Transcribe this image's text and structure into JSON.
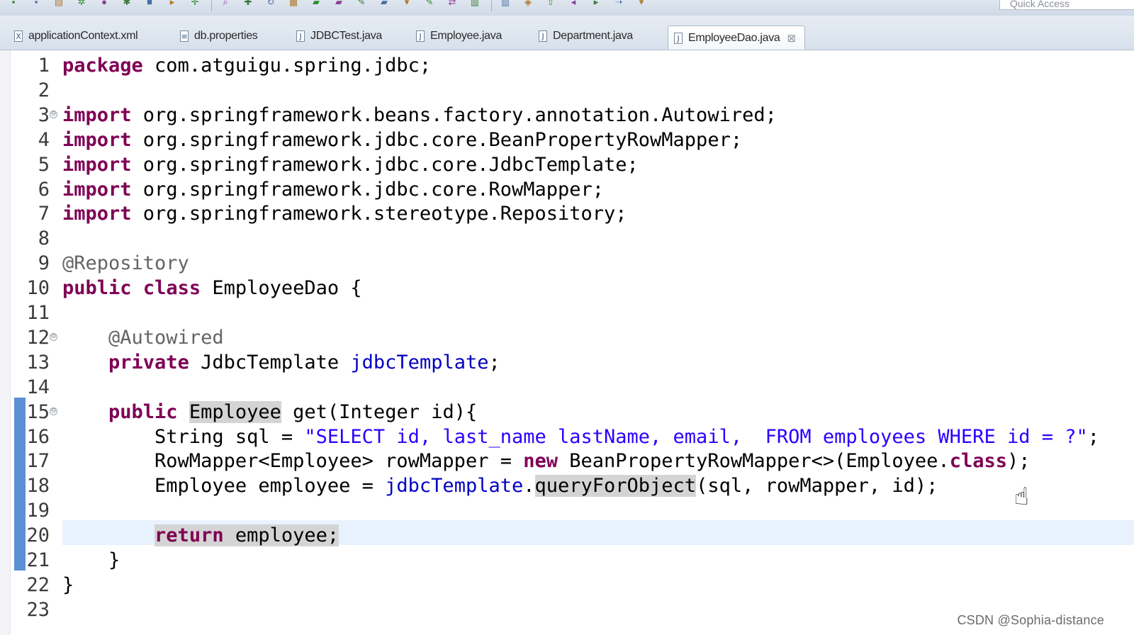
{
  "toolbar": {
    "icons": [
      "save-icon",
      "save-all-icon",
      "print-icon",
      "debug-icon",
      "run-icon",
      "run-external-icon",
      "stop-icon",
      "run-last-icon",
      "new-icon",
      "search-icon",
      "build-icon",
      "refresh-icon",
      "open-type-icon",
      "open-folder-icon",
      "open-file-icon",
      "pin-icon",
      "open-icon",
      "next-annotation-icon",
      "highlight-icon",
      "toggle-icon",
      "layout-icon",
      "columns-icon",
      "tag-icon",
      "up-icon",
      "back-icon",
      "forward-icon",
      "nav-icon",
      "menu-icon"
    ],
    "quick_access_label": "Quick Access"
  },
  "tabs": [
    {
      "label": "applicationContext.xml",
      "icon": "xml-file-icon",
      "glyph": "X",
      "active": false
    },
    {
      "label": "db.properties",
      "icon": "properties-file-icon",
      "glyph": "≡",
      "active": false
    },
    {
      "label": "JDBCTest.java",
      "icon": "java-file-icon",
      "glyph": "J",
      "active": false
    },
    {
      "label": "Employee.java",
      "icon": "java-file-icon",
      "glyph": "J",
      "active": false
    },
    {
      "label": "Department.java",
      "icon": "java-file-icon",
      "glyph": "J",
      "active": false
    },
    {
      "label": "EmployeeDao.java",
      "icon": "java-file-icon",
      "glyph": "J",
      "active": true,
      "close": "⊠"
    }
  ],
  "editor": {
    "fold_glyph": "⊖",
    "lines": [
      {
        "n": "1",
        "fold": false,
        "tokens": [
          {
            "t": "package",
            "c": "kw"
          },
          {
            "t": " com.atguigu.spring.jdbc;"
          }
        ]
      },
      {
        "n": "2",
        "fold": false,
        "tokens": []
      },
      {
        "n": "3",
        "fold": true,
        "tokens": [
          {
            "t": "import",
            "c": "kw"
          },
          {
            "t": " org.springframework.beans.factory.annotation.Autowired;"
          }
        ]
      },
      {
        "n": "4",
        "fold": false,
        "tokens": [
          {
            "t": "import",
            "c": "kw"
          },
          {
            "t": " org.springframework.jdbc.core.BeanPropertyRowMapper;"
          }
        ]
      },
      {
        "n": "5",
        "fold": false,
        "tokens": [
          {
            "t": "import",
            "c": "kw"
          },
          {
            "t": " org.springframework.jdbc.core.JdbcTemplate;"
          }
        ]
      },
      {
        "n": "6",
        "fold": false,
        "tokens": [
          {
            "t": "import",
            "c": "kw"
          },
          {
            "t": " org.springframework.jdbc.core.RowMapper;"
          }
        ]
      },
      {
        "n": "7",
        "fold": false,
        "tokens": [
          {
            "t": "import",
            "c": "kw"
          },
          {
            "t": " org.springframework.stereotype.Repository;"
          }
        ]
      },
      {
        "n": "8",
        "fold": false,
        "tokens": []
      },
      {
        "n": "9",
        "fold": false,
        "tokens": [
          {
            "t": "@Repository",
            "c": "ann"
          }
        ]
      },
      {
        "n": "10",
        "fold": false,
        "tokens": [
          {
            "t": "public",
            "c": "kw"
          },
          {
            "t": " "
          },
          {
            "t": "class",
            "c": "kw"
          },
          {
            "t": " EmployeeDao {"
          }
        ]
      },
      {
        "n": "11",
        "fold": false,
        "tokens": []
      },
      {
        "n": "12",
        "fold": true,
        "tokens": [
          {
            "t": "    "
          },
          {
            "t": "@Autowired",
            "c": "ann"
          }
        ]
      },
      {
        "n": "13",
        "fold": false,
        "tokens": [
          {
            "t": "    "
          },
          {
            "t": "private",
            "c": "kw"
          },
          {
            "t": " JdbcTemplate "
          },
          {
            "t": "jdbcTemplate",
            "c": "fld"
          },
          {
            "t": ";"
          }
        ]
      },
      {
        "n": "14",
        "fold": false,
        "tokens": []
      },
      {
        "n": "15",
        "fold": true,
        "tokens": [
          {
            "t": "    "
          },
          {
            "t": "public",
            "c": "kw"
          },
          {
            "t": " "
          },
          {
            "t": "Employee",
            "c": "occ"
          },
          {
            "t": " get(Integer id){"
          }
        ]
      },
      {
        "n": "16",
        "fold": false,
        "tokens": [
          {
            "t": "        String sql = "
          },
          {
            "t": "\"SELECT id, last_name lastName, email,  FROM employees WHERE id = ?\"",
            "c": "str"
          },
          {
            "t": ";"
          }
        ]
      },
      {
        "n": "17",
        "fold": false,
        "tokens": [
          {
            "t": "        RowMapper<Employee> rowMapper = "
          },
          {
            "t": "new",
            "c": "kw"
          },
          {
            "t": " BeanPropertyRowMapper<>(Employee."
          },
          {
            "t": "class",
            "c": "kw"
          },
          {
            "t": ");"
          }
        ]
      },
      {
        "n": "18",
        "fold": false,
        "tokens": [
          {
            "t": "        Employee employee = "
          },
          {
            "t": "jdbcTemplate",
            "c": "fld"
          },
          {
            "t": "."
          },
          {
            "t": "queryForObject",
            "c": "occ"
          },
          {
            "t": "(sql, rowMapper, id);"
          }
        ]
      },
      {
        "n": "19",
        "fold": false,
        "tokens": []
      },
      {
        "n": "20",
        "fold": false,
        "tokens": [
          {
            "t": "        "
          },
          {
            "t": "return",
            "c": "kw occ"
          },
          {
            "t": " employee;",
            "c": "occ"
          }
        ]
      },
      {
        "n": "21",
        "fold": false,
        "tokens": [
          {
            "t": "    }"
          }
        ]
      },
      {
        "n": "22",
        "fold": false,
        "tokens": [
          {
            "t": "}"
          }
        ]
      },
      {
        "n": "23",
        "fold": false,
        "tokens": []
      }
    ]
  },
  "cursor": {
    "icon": "hand-pointer-icon",
    "glyph": "☝"
  },
  "watermark": "CSDN @Sophia-distance",
  "colors": {
    "keyword": "#7f0055",
    "string": "#2a00ff",
    "field": "#0000c0",
    "annotation": "#646464",
    "change_bar": "#5b8fd6",
    "current_line": "#e8f2fe"
  }
}
